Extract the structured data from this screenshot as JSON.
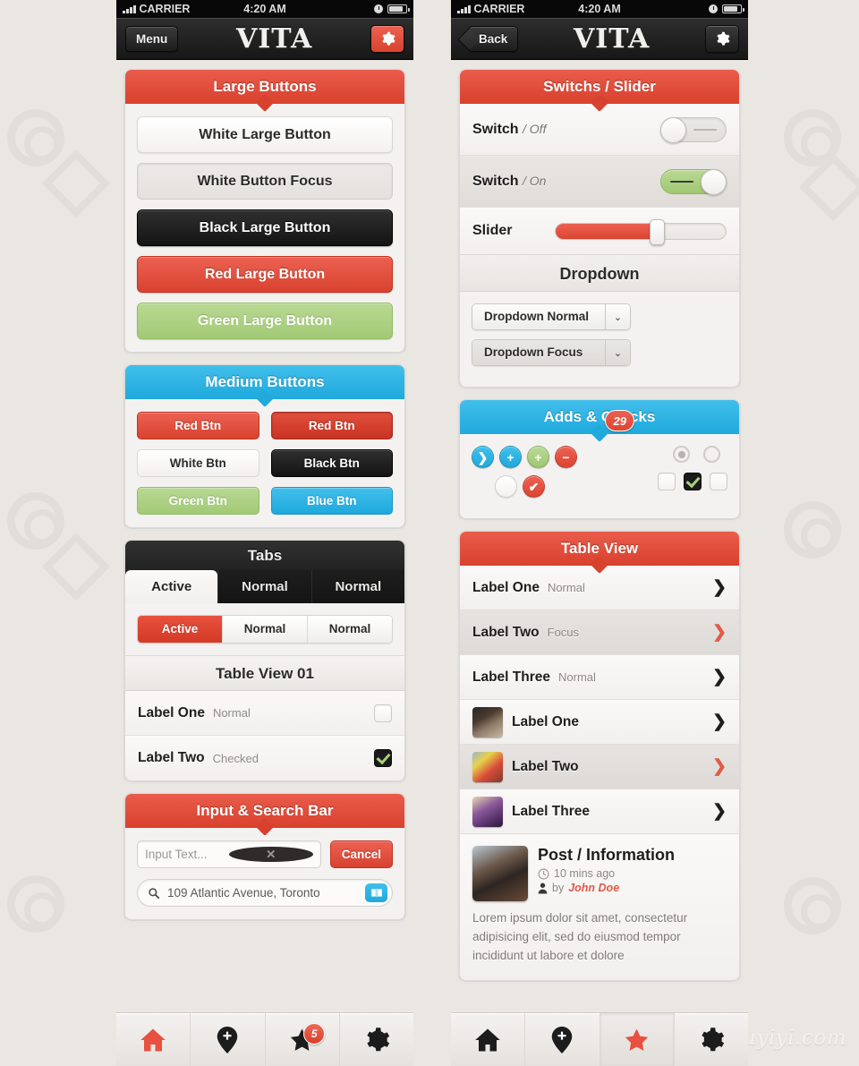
{
  "watermark": {
    "text": "Tuyiyi.com"
  },
  "left_phone": {
    "statusbar": {
      "carrier": "CARRIER",
      "time": "4:20 AM"
    },
    "navbar": {
      "left_button": "Menu",
      "title": "VITA",
      "right_icon": "gear-icon"
    },
    "large_buttons": {
      "header": "Large Buttons",
      "buttons": [
        {
          "label": "White Large Button",
          "style": "white"
        },
        {
          "label": "White Button Focus",
          "style": "whitefocus"
        },
        {
          "label": "Black Large Button",
          "style": "black"
        },
        {
          "label": "Red Large Button",
          "style": "red"
        },
        {
          "label": "Green Large Button",
          "style": "green"
        }
      ]
    },
    "medium_buttons": {
      "header": "Medium Buttons",
      "buttons": [
        {
          "label": "Red Btn",
          "style": "red"
        },
        {
          "label": "Red Btn",
          "style": "reddark"
        },
        {
          "label": "White Btn",
          "style": "white"
        },
        {
          "label": "Black Btn",
          "style": "black"
        },
        {
          "label": "Green Btn",
          "style": "green"
        },
        {
          "label": "Blue Btn",
          "style": "blue"
        }
      ]
    },
    "tabs": {
      "header": "Tabs",
      "dark_tabs": [
        {
          "label": "Active",
          "state": "active"
        },
        {
          "label": "Normal",
          "state": "normal"
        },
        {
          "label": "Normal",
          "state": "normal"
        }
      ],
      "segmented": [
        {
          "label": "Active",
          "state": "active"
        },
        {
          "label": "Normal",
          "state": "normal"
        },
        {
          "label": "Normal",
          "state": "normal"
        }
      ],
      "table_title": "Table View 01",
      "rows": [
        {
          "label": "Label One",
          "sub": "Normal",
          "checked": false
        },
        {
          "label": "Label Two",
          "sub": "Checked",
          "checked": true
        }
      ]
    },
    "input_search": {
      "header": "Input & Search Bar",
      "input_placeholder": "Input Text...",
      "clear_icon": "clear-icon",
      "cancel_label": "Cancel",
      "search_value": "109 Atlantic Avenue, Toronto",
      "search_icon": "search-icon",
      "bookmark_icon": "bookmark-icon"
    },
    "tabbar": [
      {
        "icon": "home-icon",
        "state": "active",
        "badge": null
      },
      {
        "icon": "location-pin-icon",
        "state": "normal",
        "badge": null
      },
      {
        "icon": "star-icon",
        "state": "normal",
        "badge": "5"
      },
      {
        "icon": "gear-icon",
        "state": "normal",
        "badge": null
      }
    ]
  },
  "right_phone": {
    "statusbar": {
      "carrier": "CARRIER",
      "time": "4:20 AM"
    },
    "navbar": {
      "left_button": "Back",
      "title": "VITA",
      "right_icon": "gear-icon"
    },
    "switches": {
      "header": "Switchs / Slider",
      "rows": [
        {
          "label": "Switch",
          "separator": "/",
          "state_label": "Off",
          "on": false
        },
        {
          "label": "Switch",
          "separator": "/",
          "state_label": "On",
          "on": true
        }
      ],
      "slider": {
        "label": "Slider",
        "value_percent": 59
      }
    },
    "dropdown": {
      "header": "Dropdown",
      "items": [
        {
          "label": "Dropdown Normal",
          "state": "normal",
          "icon": "chevron-down-icon"
        },
        {
          "label": "Dropdown Focus",
          "state": "focus",
          "icon": "chevron-down-icon"
        }
      ]
    },
    "adds_checks": {
      "header": "Adds & Checks",
      "row1": [
        {
          "icon": "chevron-right-icon",
          "glyph": "❯",
          "style": "blue"
        },
        {
          "icon": "plus-icon",
          "glyph": "+",
          "style": "blue"
        },
        {
          "icon": "plus-icon",
          "glyph": "+",
          "style": "green"
        },
        {
          "icon": "minus-icon",
          "glyph": "−",
          "style": "red"
        }
      ],
      "row2": [
        {
          "icon": "count-badge",
          "glyph": "29",
          "style": "badge red"
        },
        {
          "icon": "empty-circle-icon",
          "glyph": "",
          "style": "plain"
        },
        {
          "icon": "check-icon",
          "glyph": "✔",
          "style": "red"
        }
      ],
      "radios": [
        {
          "icon": "radio-selected-icon",
          "selected": true
        },
        {
          "icon": "radio-empty-icon",
          "selected": false
        }
      ],
      "checkboxes": [
        {
          "icon": "checkbox-empty-icon",
          "checked": false
        },
        {
          "icon": "checkbox-checked-icon",
          "checked": true
        },
        {
          "icon": "checkbox-empty-icon",
          "checked": false
        }
      ]
    },
    "table_view": {
      "header": "Table View",
      "rows": [
        {
          "label": "Label One",
          "sub": "Normal",
          "state": "normal",
          "thumb": false
        },
        {
          "label": "Label Two",
          "sub": "Focus",
          "state": "focus",
          "thumb": false
        },
        {
          "label": "Label Three",
          "sub": "Normal",
          "state": "normal",
          "thumb": false
        },
        {
          "label": "Label One",
          "sub": "",
          "state": "normal",
          "thumb": true
        },
        {
          "label": "Label Two",
          "sub": "",
          "state": "focus",
          "thumb": true
        },
        {
          "label": "Label Three",
          "sub": "",
          "state": "normal",
          "thumb": true
        }
      ],
      "post": {
        "title": "Post / Information",
        "time_icon": "clock-icon",
        "time": "10 mins ago",
        "author_icon": "user-icon",
        "author_prefix": "by",
        "author": "John Doe",
        "body": "Lorem ipsum dolor sit amet, consectetur adipisicing elit, sed do eiusmod tempor incididunt ut labore et dolore"
      }
    },
    "tabbar": [
      {
        "icon": "home-icon",
        "state": "normal",
        "badge": null
      },
      {
        "icon": "location-pin-icon",
        "state": "normal",
        "badge": null
      },
      {
        "icon": "star-icon",
        "state": "active",
        "badge": null
      },
      {
        "icon": "gear-icon",
        "state": "normal",
        "badge": null
      }
    ]
  },
  "colors": {
    "red": "#e8503f",
    "red_dark": "#d23a26",
    "blue": "#29b6e5",
    "green": "#a8cd7d",
    "black": "#1c1c1c",
    "background": "#eae7e3"
  }
}
